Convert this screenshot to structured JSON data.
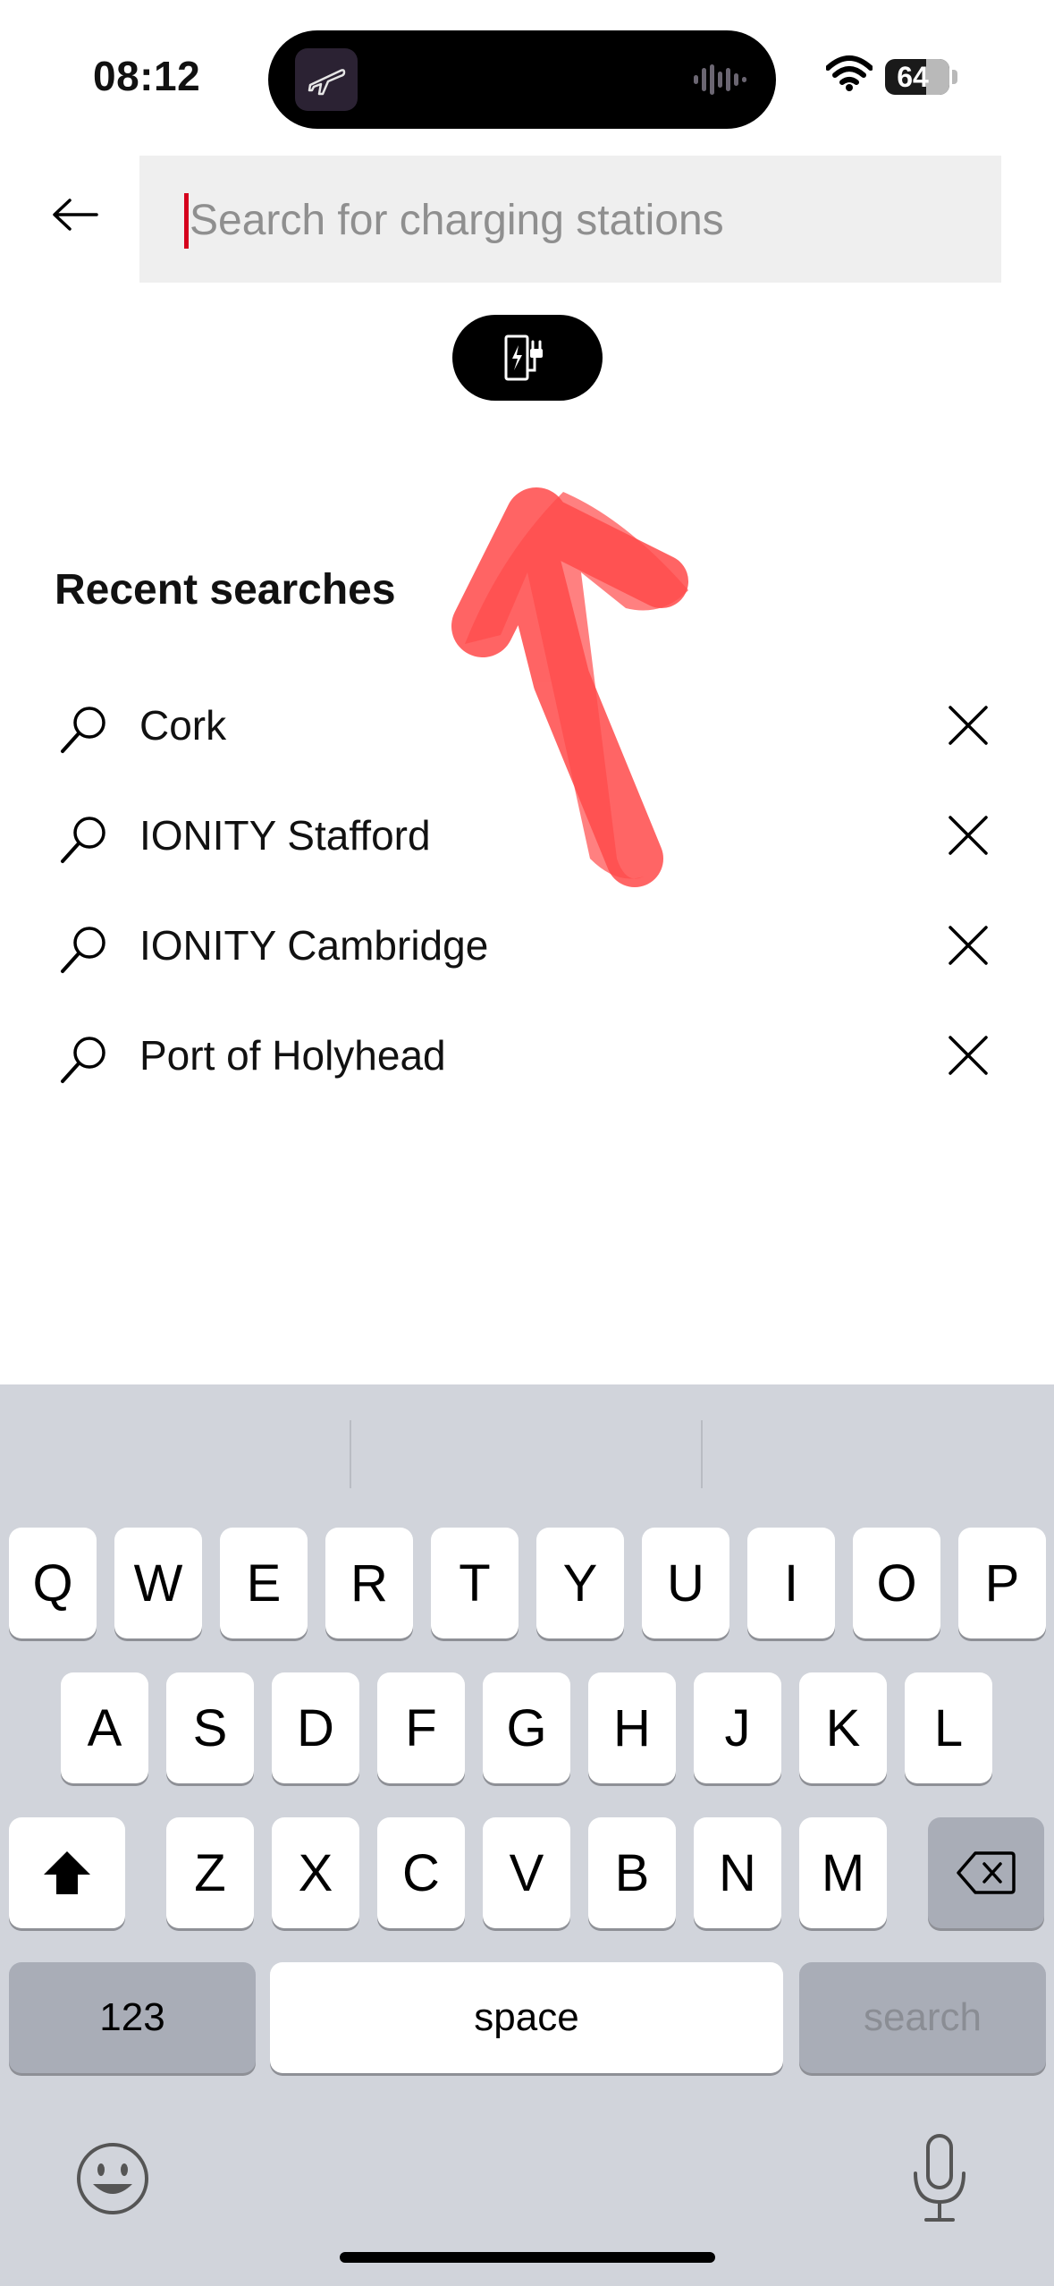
{
  "status_bar": {
    "time": "08:12",
    "battery_level": "64",
    "battery_fraction": 0.64
  },
  "search": {
    "placeholder": "Search for charging stations",
    "value": ""
  },
  "filter_chip": {
    "icon": "charging-station-icon"
  },
  "recent": {
    "title": "Recent searches",
    "items": [
      {
        "label": "Cork"
      },
      {
        "label": "IONITY Stafford"
      },
      {
        "label": "IONITY Cambridge"
      },
      {
        "label": "Port of Holyhead"
      }
    ]
  },
  "keyboard": {
    "row1": [
      "Q",
      "W",
      "E",
      "R",
      "T",
      "Y",
      "U",
      "I",
      "O",
      "P"
    ],
    "row2": [
      "A",
      "S",
      "D",
      "F",
      "G",
      "H",
      "J",
      "K",
      "L"
    ],
    "row3": [
      "Z",
      "X",
      "C",
      "V",
      "B",
      "N",
      "M"
    ],
    "numbers_label": "123",
    "space_label": "space",
    "search_label": "search"
  },
  "colors": {
    "accent_caret": "#d5001c",
    "annotation_arrow": "#ff4a4a",
    "keyboard_bg": "#d1d4db"
  }
}
